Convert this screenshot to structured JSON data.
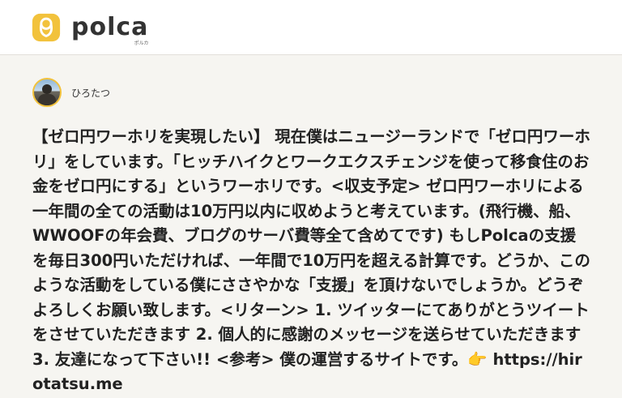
{
  "header": {
    "logo_icon": "polca-logo-icon",
    "logo_text": "polca",
    "logo_sub": "ポルカ",
    "accent_color": "#f2c23c"
  },
  "author": {
    "avatar_icon": "avatar",
    "name": "ひろたつ"
  },
  "project": {
    "description": "【ゼロ円ワーホリを実現したい】 現在僕はニュージーランドで「ゼロ円ワーホリ」をしています。「ヒッチハイクとワークエクスチェンジを使って移食住のお金をゼロ円にする」というワーホリです。<収支予定> ゼロ円ワーホリによる一年間の全ての活動は10万円以内に収めようと考えています。(飛行機、船、WWOOFの年会費、ブログのサーバ費等全て含めてです) もしPolcaの支援を毎日300円いただければ、一年間で10万円を超える計算です。どうか、このような活動をしている僕にささやかな「支援」を頂けないでしょうか。どうぞよろしくお願い致します。<リターン> 1. ツイッターにてありがとうツイートをさせていただきます 2. 個人的に感謝のメッセージを送らせていただきます 3. 友達になって下さい!! <参考> 僕の運営するサイトです。👉 https://hirotatsu.me"
  }
}
